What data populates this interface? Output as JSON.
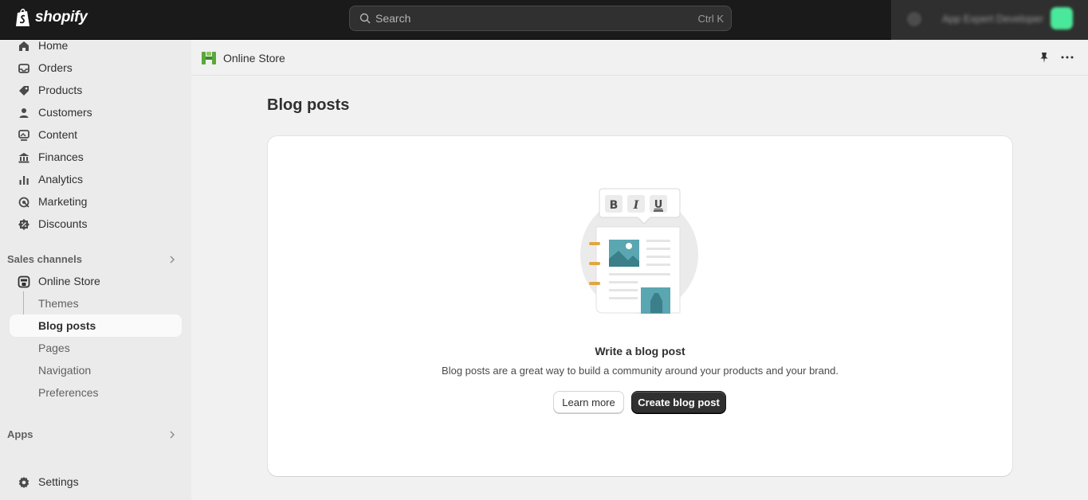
{
  "topbar": {
    "brand": "shopify",
    "search_placeholder": "Search",
    "search_shortcut": "Ctrl K",
    "account_name": "App Expert Developer"
  },
  "sidebar": {
    "items": [
      {
        "label": "Home",
        "icon": "home-icon"
      },
      {
        "label": "Orders",
        "icon": "inbox-icon"
      },
      {
        "label": "Products",
        "icon": "tag-icon"
      },
      {
        "label": "Customers",
        "icon": "person-icon"
      },
      {
        "label": "Content",
        "icon": "image-icon"
      },
      {
        "label": "Finances",
        "icon": "bank-icon"
      },
      {
        "label": "Analytics",
        "icon": "bar-chart-icon"
      },
      {
        "label": "Marketing",
        "icon": "target-icon"
      },
      {
        "label": "Discounts",
        "icon": "discount-icon"
      }
    ],
    "sales_channels_label": "Sales channels",
    "online_store_label": "Online Store",
    "sub_items": [
      "Themes",
      "Blog posts",
      "Pages",
      "Navigation",
      "Preferences"
    ],
    "apps_label": "Apps",
    "settings_label": "Settings"
  },
  "header": {
    "breadcrumb": "Online Store"
  },
  "main": {
    "title": "Blog posts",
    "empty_state": {
      "heading": "Write a blog post",
      "text": "Blog posts are a great way to build a community around your products and your brand.",
      "secondary_button": "Learn more",
      "primary_button": "Create blog post"
    }
  },
  "colors": {
    "topbar_bg": "#1a1a1a",
    "sidebar_bg": "#ebebeb",
    "primary_button": "#303030",
    "accent_teal": "#5aa6b1",
    "accent_orange": "#e0a642"
  }
}
